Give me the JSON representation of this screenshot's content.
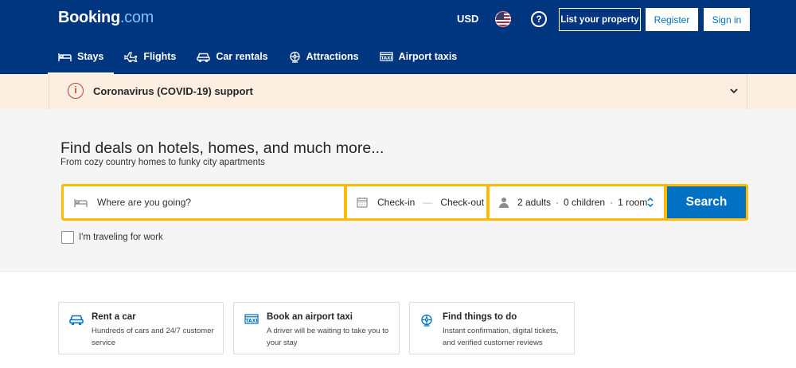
{
  "header": {
    "logo_main": "Booking",
    "logo_suffix": ".com",
    "currency": "USD",
    "help_glyph": "?",
    "list_property_label": "List your property",
    "register_label": "Register",
    "sign_in_label": "Sign in",
    "flag_icon": "us-flag-icon"
  },
  "nav": {
    "items": [
      {
        "label": "Stays",
        "icon": "bed-icon",
        "active": true
      },
      {
        "label": "Flights",
        "icon": "plane-icon"
      },
      {
        "label": "Car rentals",
        "icon": "car-icon"
      },
      {
        "label": "Attractions",
        "icon": "attractions-icon"
      },
      {
        "label": "Airport taxis",
        "icon": "taxi-icon"
      }
    ]
  },
  "covid": {
    "icon_glyph": "i",
    "text": "Coronavirus (COVID-19) support"
  },
  "hero": {
    "title": "Find deals on hotels, homes, and much more...",
    "subtitle": "From cozy country homes to funky city apartments"
  },
  "search": {
    "destination_placeholder": "Where are you going?",
    "check_in": "Check-in",
    "date_dash": "—",
    "check_out": "Check-out",
    "adults": "2 adults",
    "children": "0 children",
    "rooms": "1 room",
    "sep": "·",
    "search_label": "Search",
    "work_trip_label": "I'm traveling for work"
  },
  "cards": [
    {
      "title": "Rent a car",
      "desc": "Hundreds of cars and 24/7 customer service",
      "icon": "car-icon"
    },
    {
      "title": "Book an airport taxi",
      "desc": "A driver will be waiting to take you to your stay",
      "icon": "taxi-icon"
    },
    {
      "title": "Find things to do",
      "desc": "Instant confirmation, digital tickets, and verified customer reviews",
      "icon": "attractions-icon"
    }
  ],
  "colors": {
    "brand_blue": "#003580",
    "action_blue": "#0071c2",
    "search_yellow": "#febb02",
    "covid_bg": "#fcefe2"
  }
}
